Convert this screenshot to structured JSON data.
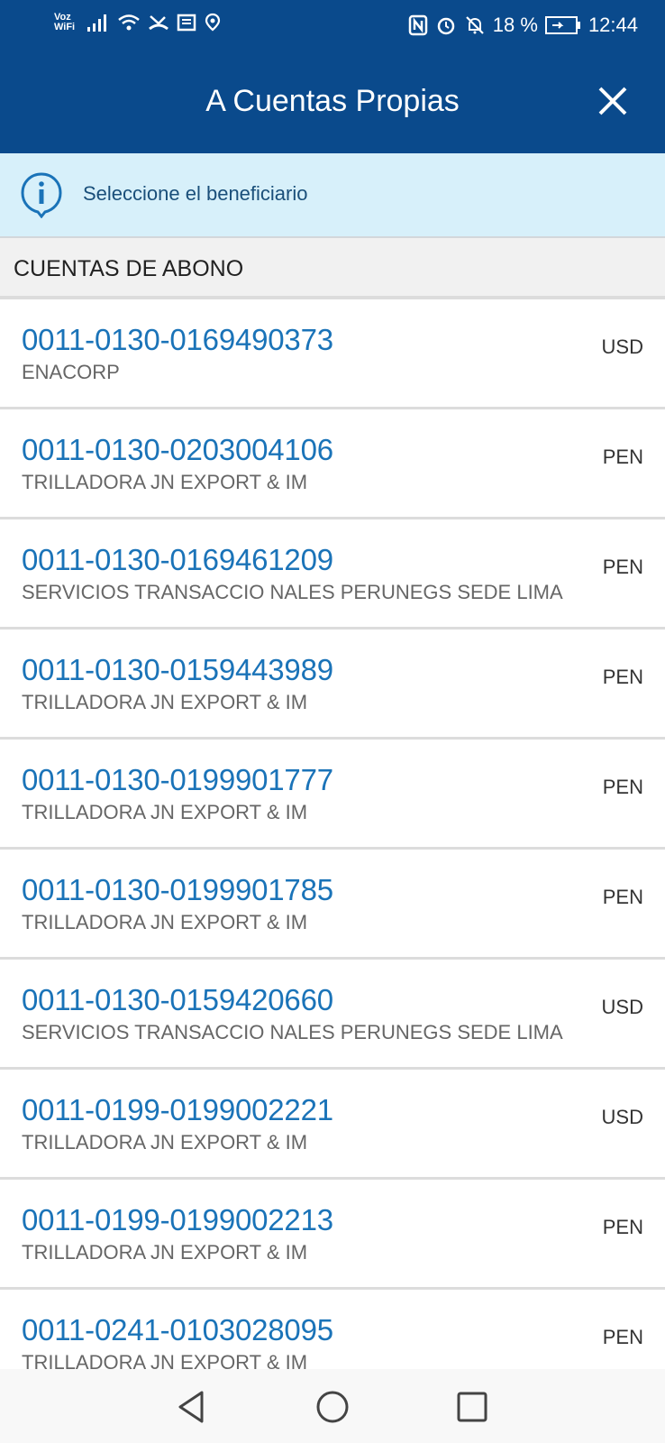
{
  "status_bar": {
    "voz_wifi": "Voz\nWiFi",
    "battery_percent": "18 %",
    "time": "12:44",
    "icons": [
      "signal-icon",
      "wifi-icon",
      "missed-call-icon",
      "notes-icon",
      "location-icon",
      "nfc-icon",
      "alarm-icon",
      "mute-notifications-icon",
      "battery-charging-icon"
    ]
  },
  "header": {
    "title": "A Cuentas Propias",
    "close_icon": "close-icon"
  },
  "info_banner": {
    "icon": "info-icon",
    "text": "Seleccione el beneficiario"
  },
  "section": {
    "title": "CUENTAS DE ABONO"
  },
  "accounts": [
    {
      "number": "0011-0130-0169490373",
      "holder": "ENACORP",
      "currency": "USD"
    },
    {
      "number": "0011-0130-0203004106",
      "holder": "TRILLADORA JN EXPORT & IM",
      "currency": "PEN"
    },
    {
      "number": "0011-0130-0169461209",
      "holder": "SERVICIOS TRANSACCIO NALES PERUNEGS SEDE LIMA",
      "currency": "PEN"
    },
    {
      "number": "0011-0130-0159443989",
      "holder": "TRILLADORA JN EXPORT & IM",
      "currency": "PEN"
    },
    {
      "number": "0011-0130-0199901777",
      "holder": "TRILLADORA JN EXPORT & IM",
      "currency": "PEN"
    },
    {
      "number": "0011-0130-0199901785",
      "holder": "TRILLADORA JN EXPORT & IM",
      "currency": "PEN"
    },
    {
      "number": "0011-0130-0159420660",
      "holder": "SERVICIOS TRANSACCIO NALES PERUNEGS SEDE LIMA",
      "currency": "USD"
    },
    {
      "number": "0011-0199-0199002221",
      "holder": "TRILLADORA JN EXPORT & IM",
      "currency": "USD"
    },
    {
      "number": "0011-0199-0199002213",
      "holder": "TRILLADORA JN EXPORT & IM",
      "currency": "PEN"
    },
    {
      "number": "0011-0241-0103028095",
      "holder": "TRILLADORA JN EXPORT & IM",
      "currency": "PEN"
    }
  ],
  "nav_bar": {
    "icons": [
      "back-icon",
      "home-icon",
      "recents-icon"
    ]
  },
  "colors": {
    "brand": "#0a4a8c",
    "link": "#1a73b8",
    "banner_bg": "#d7f0fa"
  }
}
